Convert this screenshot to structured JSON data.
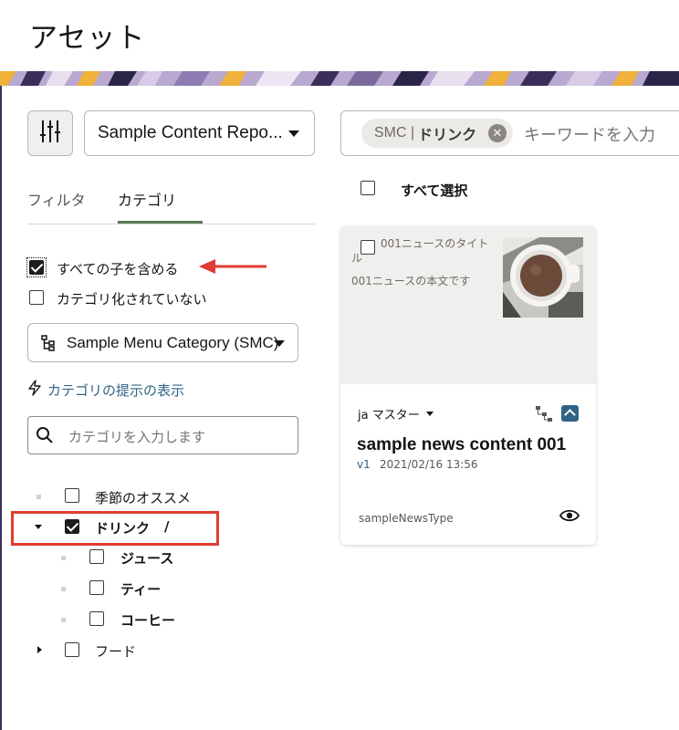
{
  "page": {
    "title": "アセット"
  },
  "toolbar": {
    "filter_icon": "sliders-icon",
    "repository": {
      "selected": "Sample Content Repo..."
    },
    "search": {
      "chip_prefix": "SMC |",
      "chip_value": "ドリンク",
      "chip_remove_icon": "close-circle-icon",
      "placeholder": "キーワードを入力"
    }
  },
  "filter_panel": {
    "tabs": [
      {
        "label": "フィルタ",
        "active": false
      },
      {
        "label": "カテゴリ",
        "active": true
      }
    ],
    "options": {
      "include_children": {
        "label": "すべての子を含める",
        "checked": true
      },
      "uncategorized": {
        "label": "カテゴリ化されていない",
        "checked": false
      }
    },
    "category_select": {
      "selected": "Sample Menu Category (SMC)",
      "icon": "hierarchy-icon"
    },
    "suggest_link": {
      "label": "カテゴリの提示の表示",
      "icon": "lightning-icon"
    },
    "category_search": {
      "placeholder": "カテゴリを入力します",
      "icon": "search-icon"
    },
    "tree": [
      {
        "label": "季節のオススメ",
        "checked": false,
        "level": 0,
        "expand": "none"
      },
      {
        "label": "ドリンク",
        "suffix": "/",
        "checked": true,
        "level": 0,
        "expand": "expanded",
        "bold": true
      },
      {
        "label": "ジュース",
        "checked": false,
        "level": 1,
        "expand": "none",
        "bold": true
      },
      {
        "label": "ティー",
        "checked": false,
        "level": 1,
        "expand": "none",
        "bold": true
      },
      {
        "label": "コーヒー",
        "checked": false,
        "level": 1,
        "expand": "none",
        "bold": true
      },
      {
        "label": "フード",
        "checked": false,
        "level": 0,
        "expand": "collapsed"
      }
    ]
  },
  "results": {
    "select_all_label": "すべて選択",
    "cards": [
      {
        "preview_title": "001ニュースのタイトル",
        "preview_body": "001ニュースの本文です",
        "language": "ja マスター",
        "name": "sample news content 001",
        "version": "v1",
        "date": "2021/02/16 13:56",
        "type": "sampleNewsType",
        "icons": [
          "hierarchy-icon",
          "chevron-up-icon",
          "eye-icon"
        ]
      }
    ]
  },
  "colors": {
    "annotation": "#e03c31",
    "link": "#2f6486",
    "tab_underline": "#5b7a53"
  }
}
